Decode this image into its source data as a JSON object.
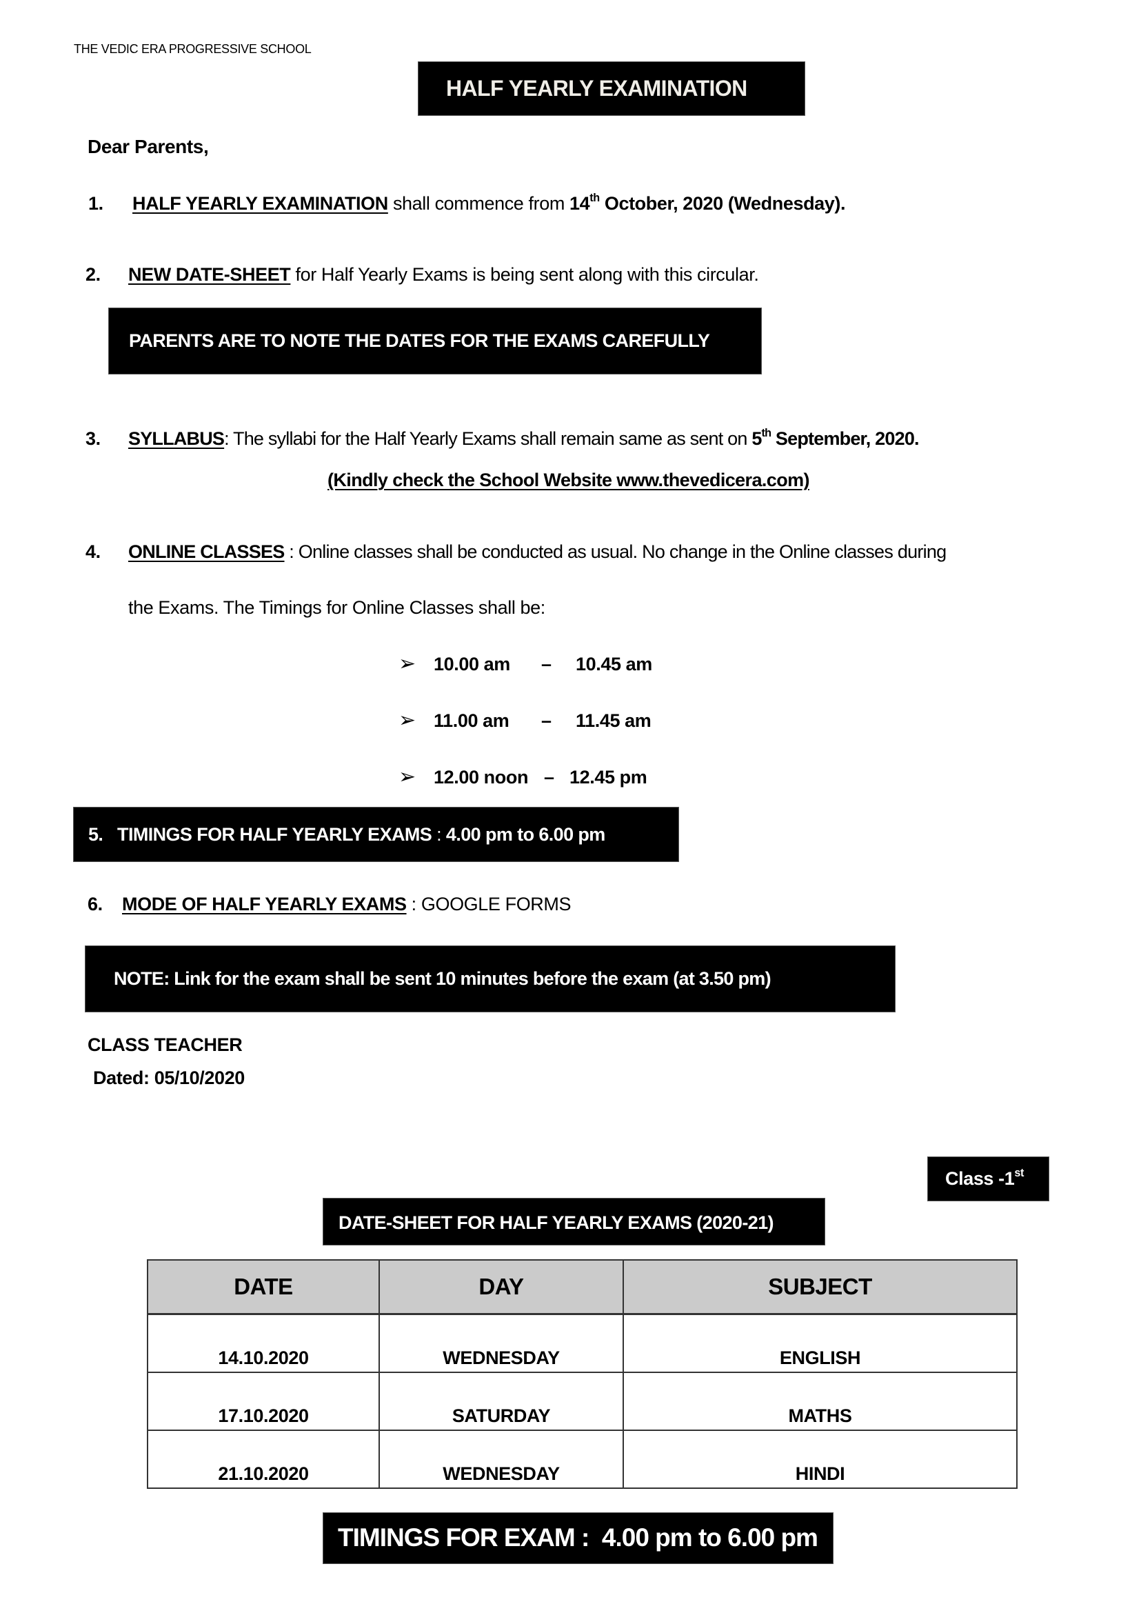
{
  "header": {
    "school_name": "THE VEDIC ERA PROGRESSIVE SCHOOL",
    "title": "HALF YEARLY EXAMINATION"
  },
  "salutation": "Dear Parents,",
  "items": {
    "item1": {
      "number": "1.",
      "label": "HALF YEARLY EXAMINATION",
      "text": " shall commence from ",
      "date_day": "14",
      "date_sup": "th",
      "date_rest": " October, 2020 (Wednesday)."
    },
    "item2": {
      "number": "2.",
      "label": "NEW DATE-SHEET",
      "text": " for Half Yearly Exams is being sent along with this circular."
    },
    "parents_note": "PARENTS ARE TO NOTE THE DATES FOR THE EXAMS CAREFULLY",
    "item3": {
      "number": "3.",
      "label": "SYLLABUS",
      "text": ": The syllabi for the Half Yearly Exams shall remain same as sent on ",
      "date_day": "5",
      "date_sup": "th",
      "date_rest": " September, 2020.",
      "website_note": "(Kindly check the School Website www.thevedicera.com)"
    },
    "item4": {
      "number": "4.",
      "label": "ONLINE CLASSES",
      "text_line1": " : Online classes shall be conducted as usual. No change in the Online classes during",
      "text_line2": "the Exams. The Timings for Online Classes shall be:",
      "bullet_icon": "arrowhead-bullet",
      "timings": [
        {
          "start": "10.00 am",
          "sep": "–",
          "end": "10.45 am"
        },
        {
          "start": "11.00 am",
          "sep": "–",
          "end": "11.45 am"
        },
        {
          "start": "12.00 noon",
          "sep": "–",
          "end": "12.45 pm"
        }
      ]
    },
    "item5": {
      "number": "5.",
      "label": "TIMINGS FOR HALF YEARLY EXAMS",
      "sep": " : ",
      "value": "4.00 pm to 6.00 pm"
    },
    "item6": {
      "number": "6.",
      "label": "MODE OF HALF YEARLY EXAMS",
      "sep": " : ",
      "value": "GOOGLE FORMS"
    },
    "note": "NOTE: Link for the exam shall be sent 10 minutes before the exam (at 3.50 pm)"
  },
  "signature": {
    "role": "CLASS TEACHER",
    "dated": "Dated: 05/10/2020"
  },
  "datesheet": {
    "class_label": "Class -1",
    "class_sup": "st",
    "title": "DATE-SHEET FOR HALF YEARLY EXAMS (2020-21)",
    "columns": [
      "DATE",
      "DAY",
      "SUBJECT"
    ],
    "rows": [
      [
        "14.10.2020",
        "WEDNESDAY",
        "ENGLISH"
      ],
      [
        "17.10.2020",
        "SATURDAY",
        "MATHS"
      ],
      [
        "21.10.2020",
        "WEDNESDAY",
        "HINDI"
      ]
    ],
    "timings": "TIMINGS FOR EXAM :  4.00 pm to 6.00 pm"
  },
  "colors": {
    "box_bg": "#000000",
    "box_text": "#ffffff",
    "table_header_bg": "#cbcbcb"
  }
}
